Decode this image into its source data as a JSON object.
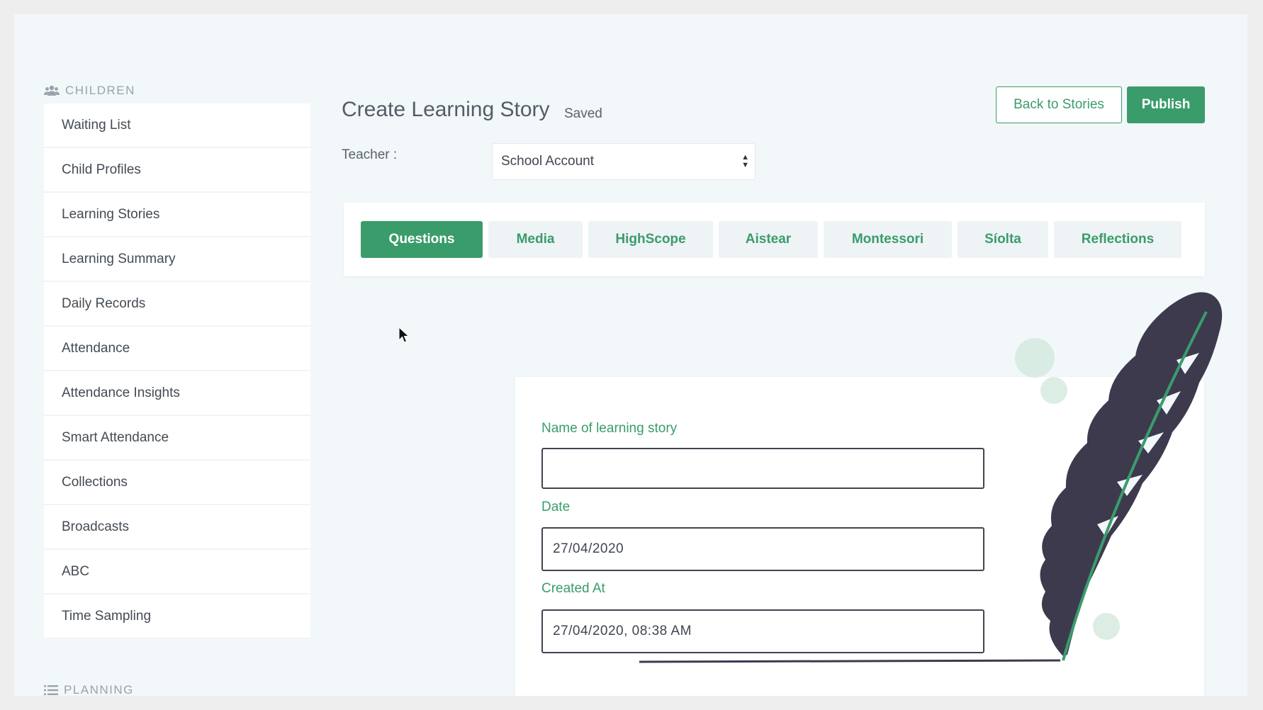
{
  "sidebar": {
    "children_heading": "CHILDREN",
    "items": [
      {
        "label": "Waiting List"
      },
      {
        "label": "Child Profiles"
      },
      {
        "label": "Learning Stories"
      },
      {
        "label": "Learning Summary"
      },
      {
        "label": "Daily Records"
      },
      {
        "label": "Attendance"
      },
      {
        "label": "Attendance Insights"
      },
      {
        "label": "Smart Attendance"
      },
      {
        "label": "Collections"
      },
      {
        "label": "Broadcasts"
      },
      {
        "label": "ABC"
      },
      {
        "label": "Time Sampling"
      }
    ],
    "planning_heading": "PLANNING"
  },
  "header": {
    "title": "Create Learning Story",
    "status": "Saved",
    "back_label": "Back to Stories",
    "publish_label": "Publish"
  },
  "teacher": {
    "label": "Teacher :",
    "selected": "School Account"
  },
  "tabs": [
    {
      "label": "Questions",
      "active": true
    },
    {
      "label": "Media",
      "active": false
    },
    {
      "label": "HighScope",
      "active": false
    },
    {
      "label": "Aistear",
      "active": false
    },
    {
      "label": "Montessori",
      "active": false
    },
    {
      "label": "Síolta",
      "active": false
    },
    {
      "label": "Reflections",
      "active": false
    }
  ],
  "form": {
    "name_label": "Name of learning story",
    "name_value": "",
    "date_label": "Date",
    "date_value": "27/04/2020",
    "created_label": "Created At",
    "created_value": "27/04/2020, 08:38 AM"
  },
  "colors": {
    "accent": "#3a9c6b",
    "feather": "#3d3a4e",
    "background": "#f2f7fa"
  }
}
